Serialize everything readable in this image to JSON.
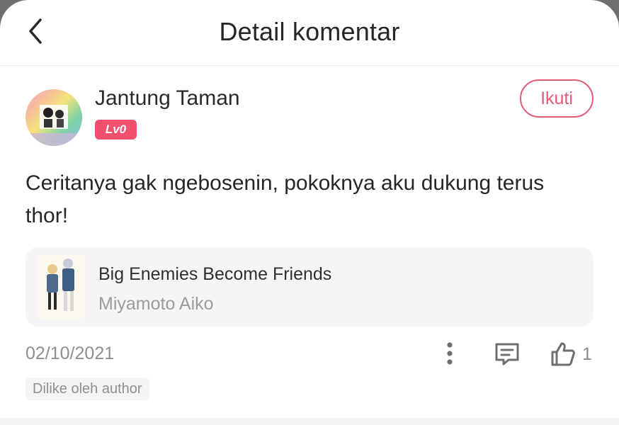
{
  "header": {
    "title": "Detail komentar",
    "back_icon": "chevron-left-icon"
  },
  "user": {
    "name": "Jantung Taman",
    "level": "Lv0",
    "follow_label": "Ikuti"
  },
  "comment": {
    "text": "Ceritanya gak ngebosenin, pokoknya aku dukung terus thor!"
  },
  "book": {
    "title": "Big Enemies Become Friends",
    "author": "Miyamoto Aiko"
  },
  "meta": {
    "date": "02/10/2021",
    "like_count": "1",
    "liked_tag": "Dilike oleh author",
    "icons": [
      "more-vertical-icon",
      "reply-comment-icon",
      "thumbs-up-icon"
    ]
  },
  "colors": {
    "accent": "#e25d74",
    "badge": "#f0506e",
    "muted": "#8f8f8f"
  }
}
